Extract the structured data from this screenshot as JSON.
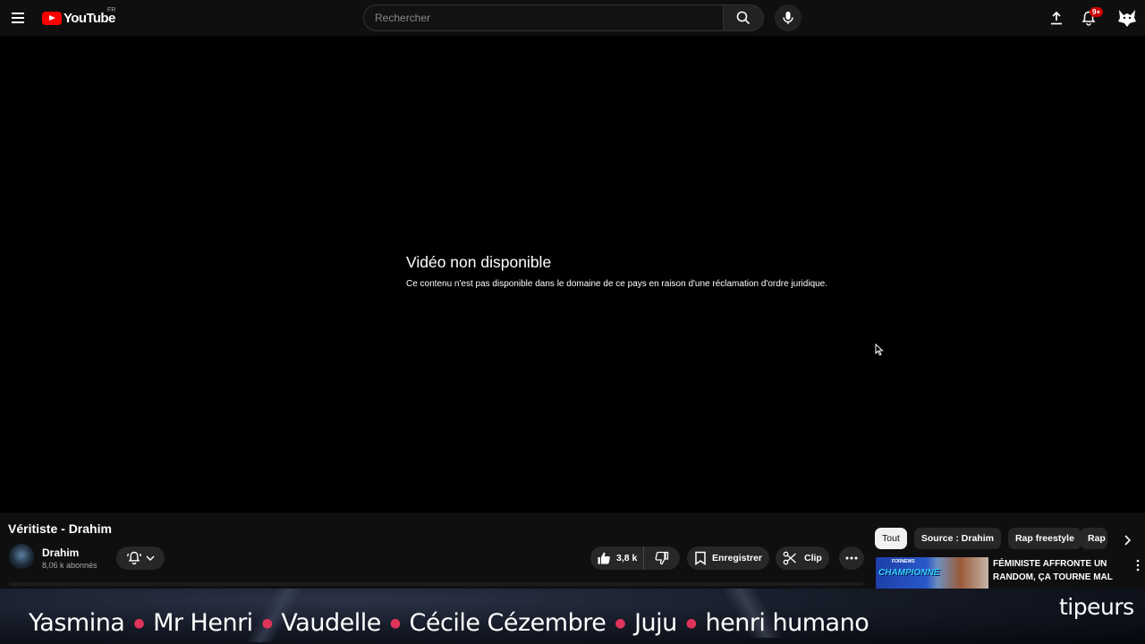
{
  "header": {
    "logo_text": "YouTube",
    "country_code": "FR",
    "search_placeholder": "Rechercher",
    "notification_count": "9+"
  },
  "player": {
    "unavailable_title": "Vidéo non disponible",
    "unavailable_message": "Ce contenu n'est pas disponible dans le domaine de ce pays en raison d'une réclamation d'ordre juridique."
  },
  "video": {
    "title": "Véritiste - Drahim",
    "channel_name": "Drahim",
    "subscribers": "8,06 k abonnés",
    "like_count": "3,8 k",
    "save_label": "Enregistrer",
    "clip_label": "Clip"
  },
  "chips": [
    {
      "label": "Tout",
      "active": true
    },
    {
      "label": "Source : Drahim",
      "active": false
    },
    {
      "label": "Rap freestyle",
      "active": false
    },
    {
      "label": "Rap",
      "active": false
    }
  ],
  "suggestion": {
    "title": "FÉMINISTE AFFRONTE UN RANDOM, ÇA TOURNE MAL",
    "thumb_text": "CHAMPIONNE",
    "thumb_small": "FORNEWS"
  },
  "overlay": {
    "names": [
      "Yasmina",
      "Mr Henri",
      "Vaudelle",
      "Cécile Cézembre",
      "Juju",
      "henri humano"
    ],
    "brand": "tipeurs"
  },
  "colors": {
    "accent": "#ff0000",
    "badge": "#cc0000",
    "name_separator": "#e0335a"
  }
}
